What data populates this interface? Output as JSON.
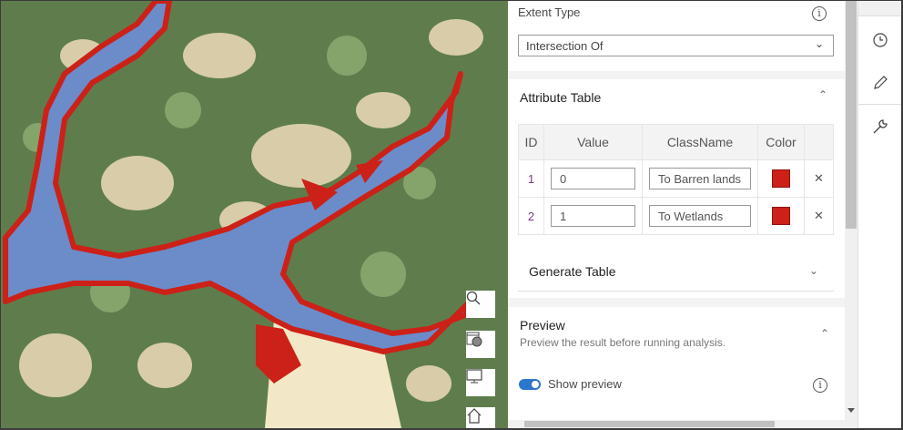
{
  "colors": {
    "water": "#6b8cc9",
    "change": "#cc2118",
    "forest": "#5f7d4c",
    "barren": "#e8d8b5",
    "accent": "#2b76cc"
  },
  "extent": {
    "label": "Extent Type",
    "value": "Intersection Of"
  },
  "attribute_table": {
    "title": "Attribute Table",
    "columns": [
      "ID",
      "Value",
      "ClassName",
      "Color"
    ],
    "rows": [
      {
        "id": "1",
        "value": "0",
        "class_name": "To Barren lands",
        "color": "#cc2118"
      },
      {
        "id": "2",
        "value": "1",
        "class_name": "To Wetlands",
        "color": "#cc2118"
      }
    ]
  },
  "generate_table": {
    "title": "Generate Table"
  },
  "preview": {
    "title": "Preview",
    "description": "Preview the result before running analysis.",
    "toggle_label": "Show preview",
    "toggle_on": true
  },
  "map_tools": [
    "search-icon",
    "basemap-gallery-icon",
    "fullscreen-icon",
    "home-icon"
  ],
  "right_tools": [
    "history-icon",
    "edit-icon",
    "wrench-icon"
  ]
}
